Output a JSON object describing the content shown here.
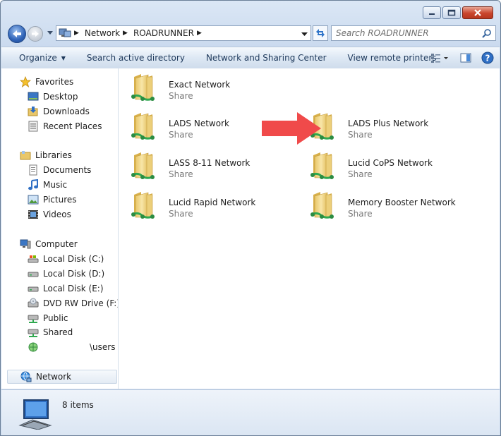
{
  "address": {
    "crumbs": [
      "Network",
      "ROADRUNNER"
    ]
  },
  "search": {
    "placeholder": "Search ROADRUNNER"
  },
  "toolbar": {
    "organize": "Organize",
    "search_ad": "Search active directory",
    "network_sharing": "Network and Sharing Center",
    "remote_printers": "View remote printers"
  },
  "nav": {
    "favorites": {
      "label": "Favorites",
      "items": [
        "Desktop",
        "Downloads",
        "Recent Places"
      ]
    },
    "libraries": {
      "label": "Libraries",
      "items": [
        "Documents",
        "Music",
        "Pictures",
        "Videos"
      ]
    },
    "computer": {
      "label": "Computer",
      "items": [
        "Local Disk (C:)",
        "Local Disk (D:)",
        "Local Disk (E:)",
        "DVD RW Drive (F:) LA",
        "Public",
        "Shared",
        "\\users"
      ]
    },
    "network": {
      "label": "Network"
    }
  },
  "shares": [
    {
      "name": "Exact Network",
      "type": "Share"
    },
    {
      "name": "LADS Network",
      "type": "Share"
    },
    {
      "name": "LADS Plus Network",
      "type": "Share"
    },
    {
      "name": "LASS 8-11 Network",
      "type": "Share"
    },
    {
      "name": "Lucid CoPS Network",
      "type": "Share"
    },
    {
      "name": "Lucid Rapid Network",
      "type": "Share"
    },
    {
      "name": "Memory Booster Network",
      "type": "Share"
    }
  ],
  "status": {
    "item_count": "8 items"
  },
  "colors": {
    "annotation_arrow": "#f04a4a",
    "folder": "#f0d67e",
    "share_badge": "#2fa84f"
  }
}
